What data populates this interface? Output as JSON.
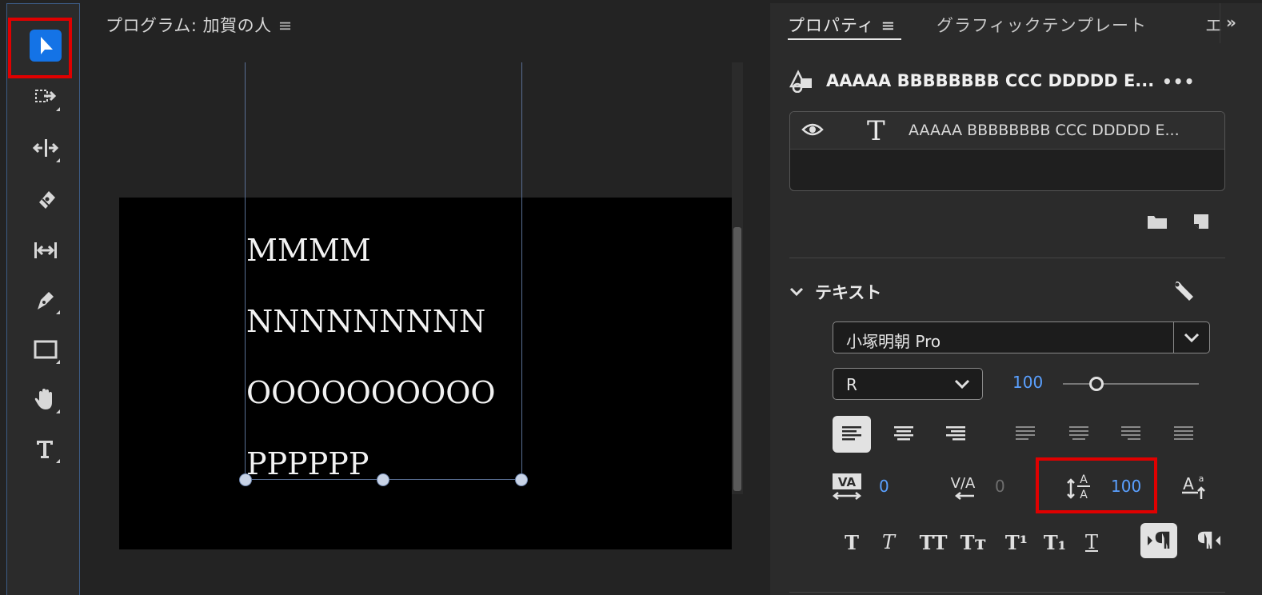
{
  "program": {
    "title": "プログラム: 加賀の人",
    "menu_glyph": "≡",
    "video_lines": [
      "MMMM",
      "NNNNNNNNN",
      "OOOOOOOOOO",
      "PPPPPP"
    ]
  },
  "tabs": {
    "properties": "プロパティ",
    "properties_menu": "≡",
    "graphics_templates": "グラフィックテンプレート",
    "overflow": "エ",
    "chevron": "»"
  },
  "layer": {
    "title": "AAAAA BBBBBBBB CCC DDDDD E...",
    "more": "•••",
    "row_name": "AAAAA BBBBBBBB CCC DDDDD E...",
    "type_glyph": "T"
  },
  "text_section": {
    "label": "テキスト",
    "font_family": "小塚明朝 Pro",
    "font_style": "R",
    "font_size": "100",
    "kerning": "0",
    "tracking": "0",
    "leading": "100"
  },
  "style_buttons": [
    "T",
    "T",
    "TT",
    "Tт",
    "T¹",
    "T₁",
    "T"
  ],
  "colors": {
    "accent_blue": "#1473e6",
    "value_blue": "#5aa0ff",
    "highlight_red": "#e00000"
  }
}
